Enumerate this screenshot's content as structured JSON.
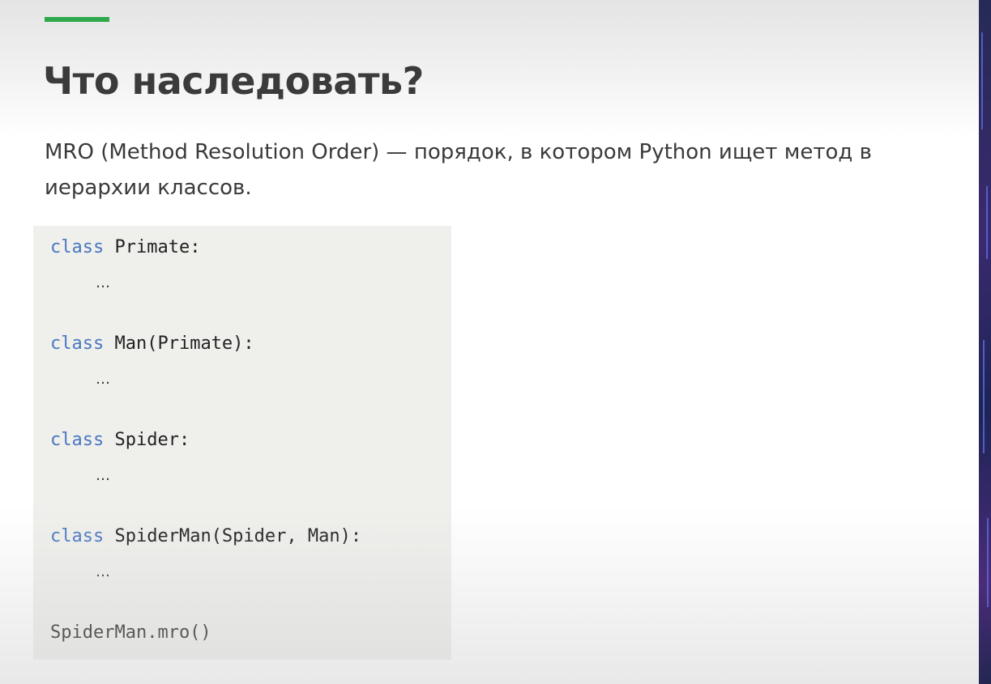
{
  "slide": {
    "title": "Что наследовать?",
    "subtitle": "MRO (Method Resolution Order) — порядок, в котором Python ищет метод в иерархии классов.",
    "accent_color": "#2da84a"
  },
  "code": {
    "keyword": "class",
    "keyword_color": "#4a78c2",
    "lines": [
      {
        "keyword": "class",
        "text": " Primate:"
      },
      {
        "text": "…"
      },
      {
        "keyword": "class",
        "text": " Man(Primate):"
      },
      {
        "text": "…"
      },
      {
        "keyword": "class",
        "text": " Spider:"
      },
      {
        "text": "…"
      },
      {
        "keyword": "class",
        "text": " SpiderMan(Spider, Man):"
      },
      {
        "text": "…"
      },
      {
        "text": "SpiderMan.mro()"
      }
    ]
  }
}
